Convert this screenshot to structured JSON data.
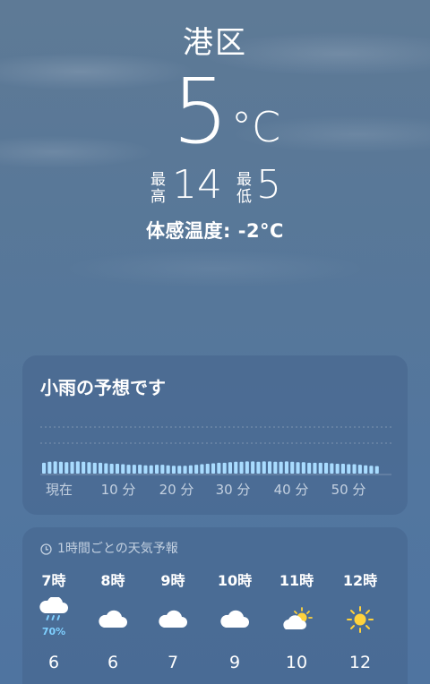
{
  "location": "港区",
  "current": {
    "temp": "5",
    "unit": "°C",
    "high_label": "最高",
    "high": "14",
    "low_label": "最低",
    "low": "5",
    "feels_like": "体感温度: -2°C"
  },
  "rain_card": {
    "title": "小雨の予想です",
    "time_labels": [
      "現在",
      "10 分",
      "20 分",
      "30 分",
      "40 分",
      "50 分"
    ],
    "precip_intensity": [
      0.55,
      0.6,
      0.62,
      0.6,
      0.58,
      0.6,
      0.62,
      0.6,
      0.58,
      0.55,
      0.55,
      0.52,
      0.5,
      0.5,
      0.48,
      0.45,
      0.45,
      0.45,
      0.42,
      0.42,
      0.45,
      0.45,
      0.42,
      0.4,
      0.4,
      0.4,
      0.42,
      0.45,
      0.48,
      0.5,
      0.52,
      0.55,
      0.55,
      0.58,
      0.6,
      0.6,
      0.62,
      0.62,
      0.6,
      0.62,
      0.62,
      0.6,
      0.6,
      0.62,
      0.6,
      0.58,
      0.58,
      0.55,
      0.55,
      0.55,
      0.55,
      0.52,
      0.5,
      0.5,
      0.48,
      0.48,
      0.45,
      0.42,
      0.4,
      0.38
    ]
  },
  "hourly": {
    "header": "1時間ごとの天気予報",
    "items": [
      {
        "hour": "7時",
        "icon": "rain-cloud-icon",
        "precip": "70%",
        "temp": "6"
      },
      {
        "hour": "8時",
        "icon": "cloud-icon",
        "precip": "",
        "temp": "6"
      },
      {
        "hour": "9時",
        "icon": "cloud-icon",
        "precip": "",
        "temp": "7"
      },
      {
        "hour": "10時",
        "icon": "cloud-icon",
        "precip": "",
        "temp": "9"
      },
      {
        "hour": "11時",
        "icon": "partly-sunny-icon",
        "precip": "",
        "temp": "10"
      },
      {
        "hour": "12時",
        "icon": "sun-icon",
        "precip": "",
        "temp": "12"
      }
    ]
  },
  "colors": {
    "rain_bar": "#a9dcff",
    "precip_text": "#7fd0ff",
    "sun": "#ffd23c"
  }
}
